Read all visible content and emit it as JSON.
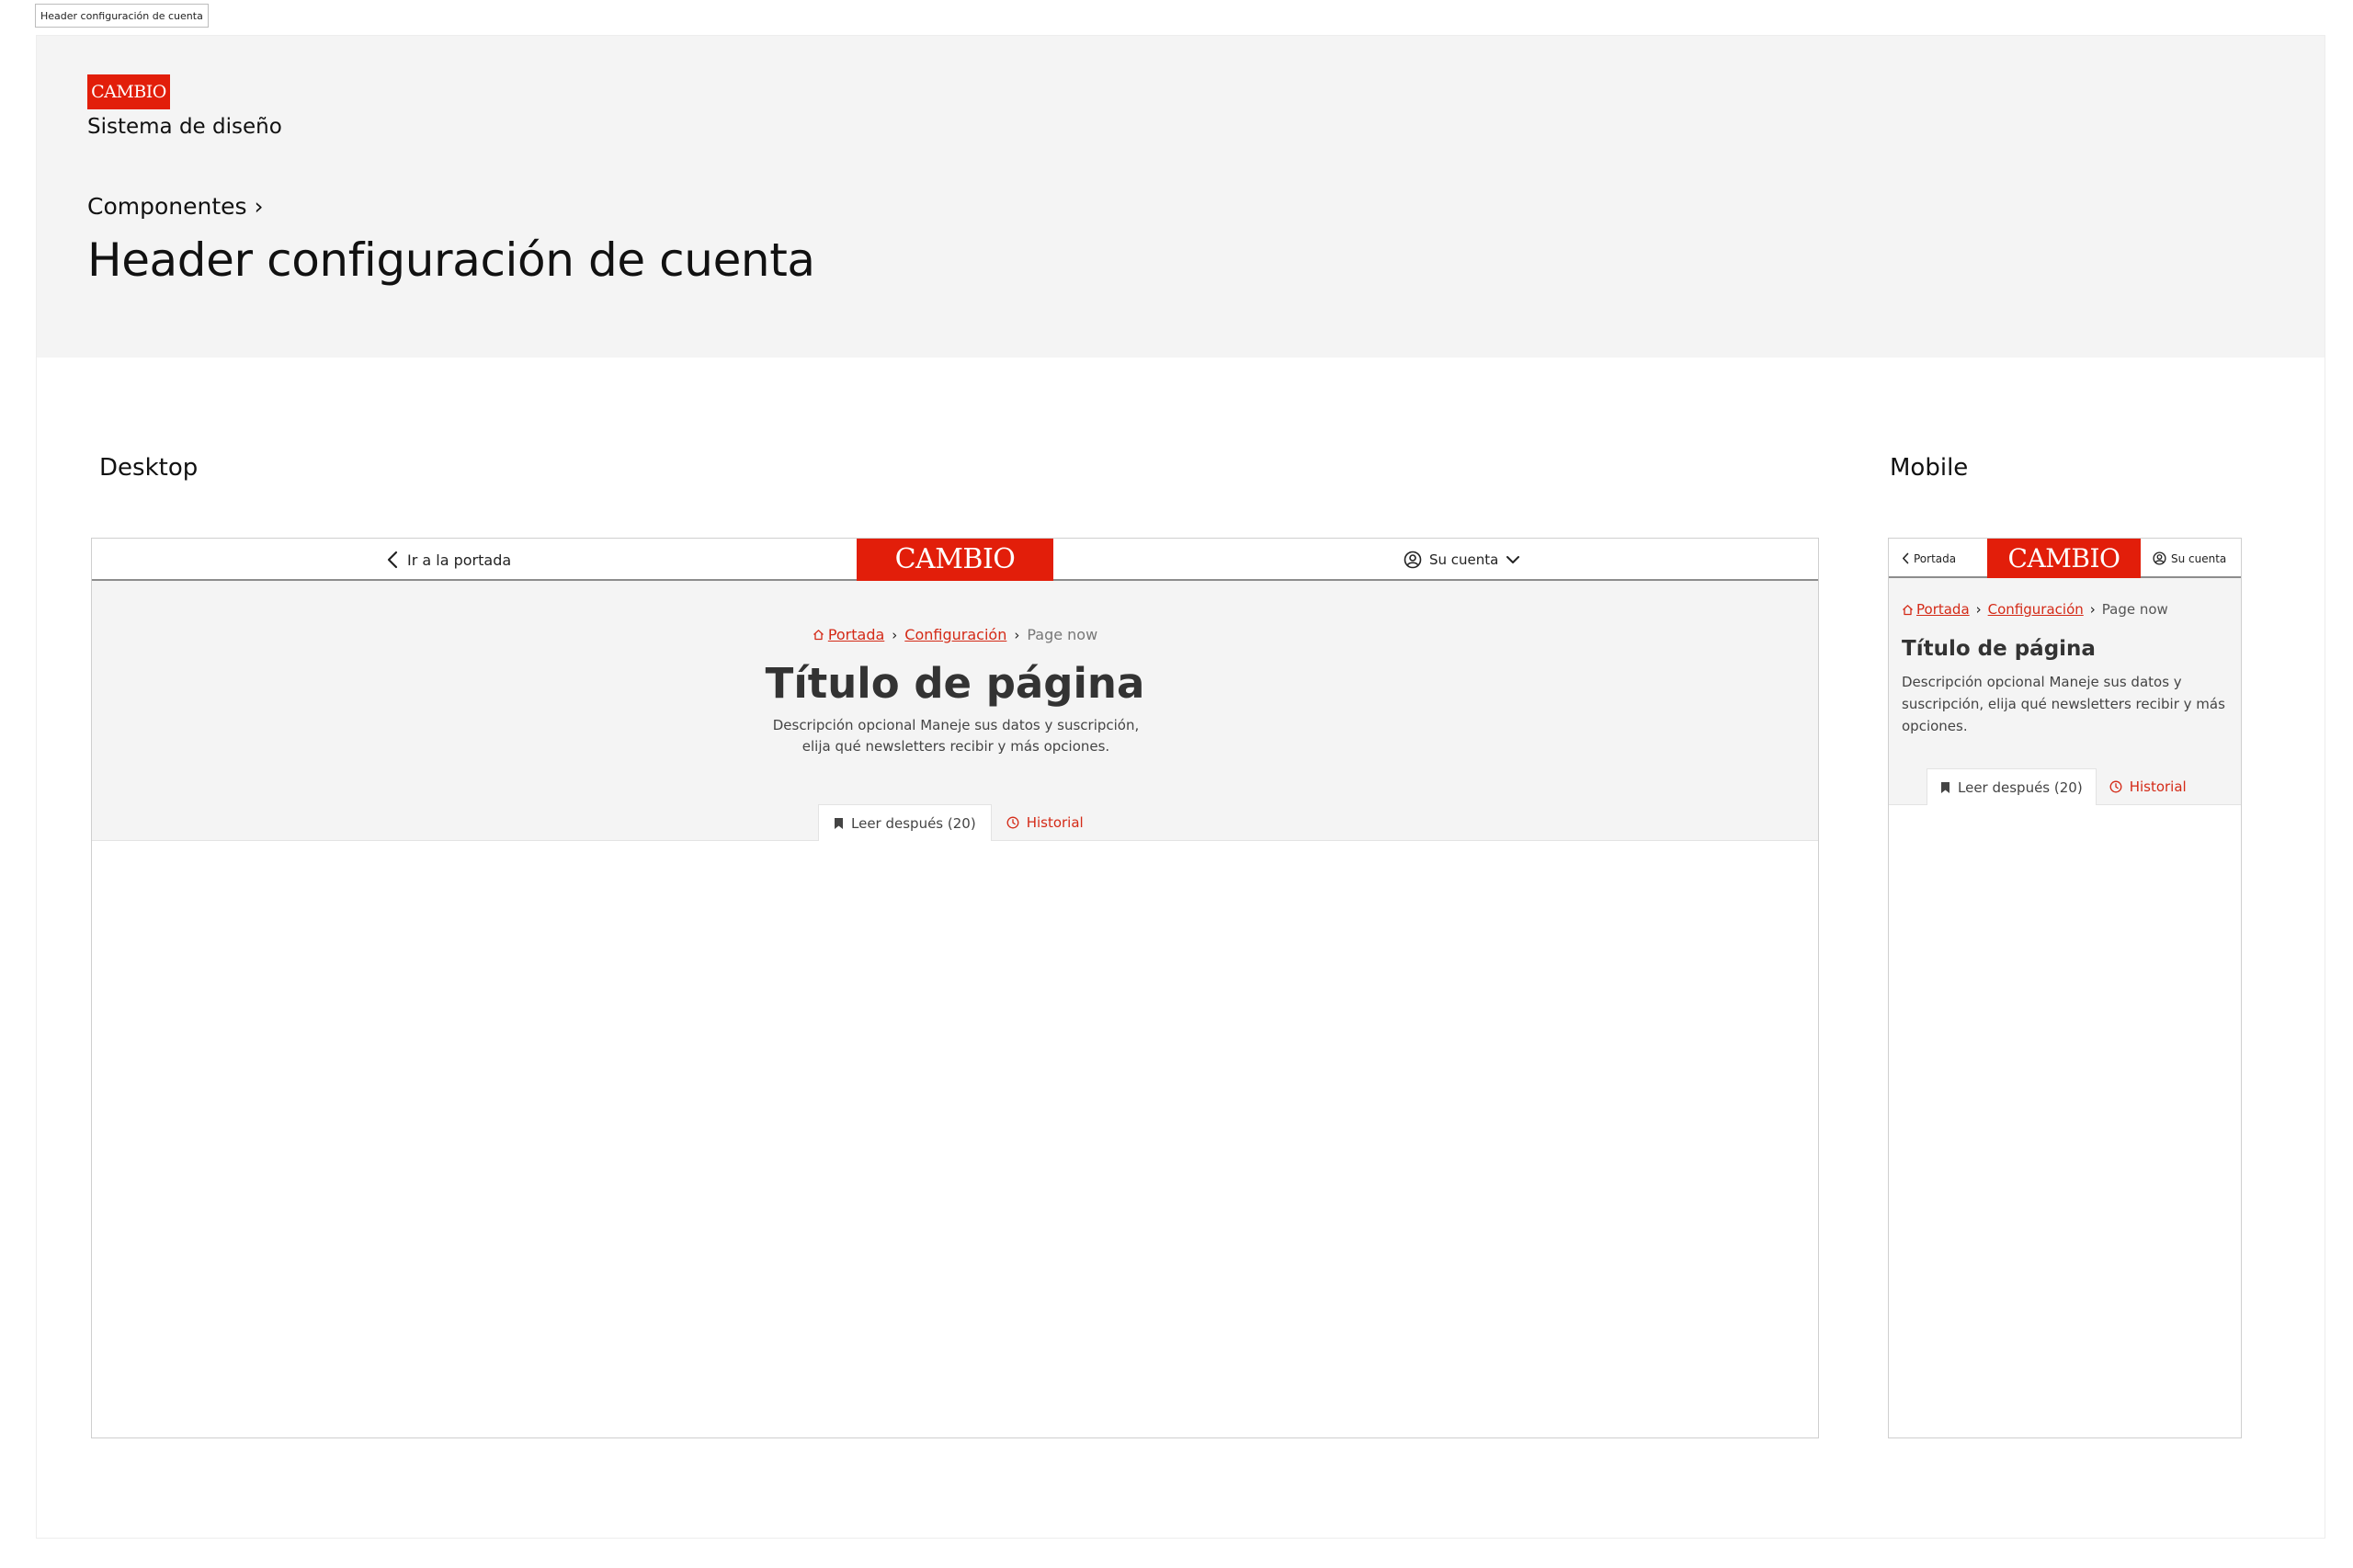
{
  "frame_label": "Header configuración de cuenta",
  "hero": {
    "logo": "CAMBIO",
    "subtitle": "Sistema de diseño",
    "breadcrumb": "Componentes ›",
    "title": "Header configuración de cuenta"
  },
  "sections": {
    "desktop_label": "Desktop",
    "mobile_label": "Mobile"
  },
  "colors": {
    "brand": "#e21e0a",
    "link": "#d42a17",
    "header_bg": "#f4f4f4"
  },
  "desktop": {
    "back_label": "Ir a la portada",
    "logo": "CAMBIO",
    "account_label": "Su cuenta",
    "breadcrumb": {
      "home": "Portada",
      "config": "Configuración",
      "current": "Page now",
      "separator": "›"
    },
    "title": "Título de página",
    "description": "Descripción opcional Maneje sus datos y suscripción, elija qué newsletters recibir y más opciones.",
    "tabs": [
      {
        "label": "Leer después (20)",
        "icon": "bookmark-icon",
        "active": true
      },
      {
        "label": "Historial",
        "icon": "clock-icon",
        "active": false
      }
    ]
  },
  "mobile": {
    "back_label": "Portada",
    "logo": "CAMBIO",
    "account_label": "Su cuenta",
    "breadcrumb": {
      "home": "Portada",
      "config": "Configuración",
      "current": "Page now",
      "separator": "›"
    },
    "title": "Título de página",
    "description": "Descripción opcional Maneje sus datos y suscripción, elija qué newsletters recibir y más opciones.",
    "tabs": [
      {
        "label": "Leer después (20)",
        "icon": "bookmark-icon",
        "active": true
      },
      {
        "label": "Historial",
        "icon": "clock-icon",
        "active": false
      }
    ]
  }
}
